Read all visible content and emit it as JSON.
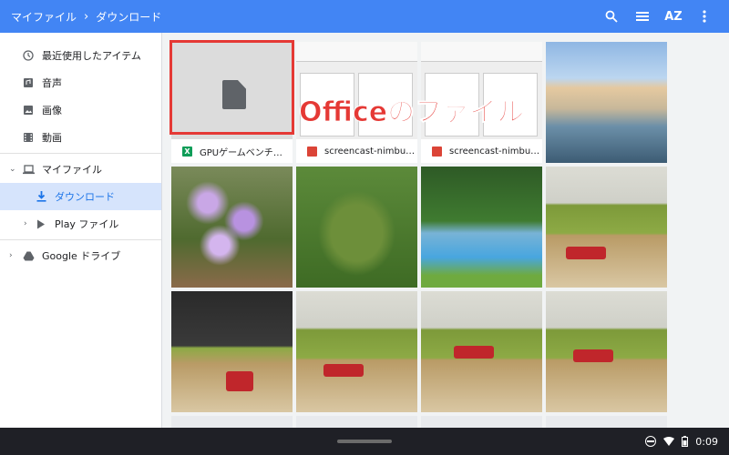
{
  "breadcrumb": {
    "root": "マイファイル",
    "separator": "›",
    "current": "ダウンロード"
  },
  "toolbar": {
    "search_icon": "search-icon",
    "list_icon": "list-view-icon",
    "sort_label": "AZ",
    "more_icon": "more-vert-icon"
  },
  "sidebar": {
    "items": [
      {
        "label": "最近使用したアイテム",
        "icon": "clock-icon"
      },
      {
        "label": "音声",
        "icon": "audio-icon"
      },
      {
        "label": "画像",
        "icon": "image-icon"
      },
      {
        "label": "動画",
        "icon": "video-icon"
      },
      {
        "label": "マイファイル",
        "icon": "laptop-icon"
      },
      {
        "label": "ダウンロード",
        "icon": "download-icon"
      },
      {
        "label": "Play ファイル",
        "icon": "play-icon"
      },
      {
        "label": "Google ドライブ",
        "icon": "drive-icon"
      }
    ]
  },
  "files": {
    "f1": {
      "name": "GPUゲームベンチマ..."
    },
    "f2": {
      "name": "screencast-nimbus-..."
    },
    "f3": {
      "name": "screencast-nimbus-..."
    }
  },
  "overlay": {
    "label": "Officeのファイル"
  },
  "shelf": {
    "time": "0:09"
  },
  "colors": {
    "accent": "#4285f4",
    "annotation": "#e53935",
    "selected": "#d6e4fc"
  }
}
